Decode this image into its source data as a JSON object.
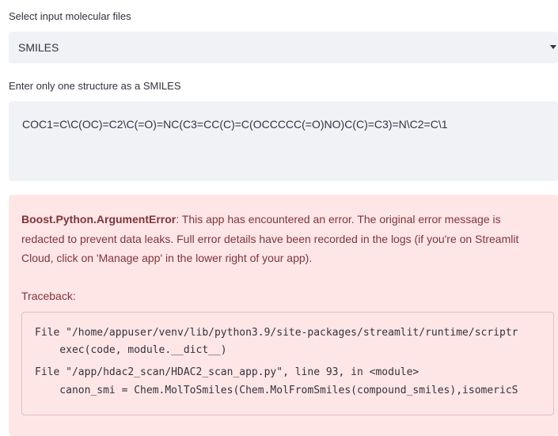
{
  "file_select": {
    "label": "Select input molecular files",
    "value": "SMILES",
    "icon": "chevron-down-icon"
  },
  "smiles_input": {
    "label": "Enter only one structure as a SMILES",
    "value": "COC1=C\\C(OC)=C2\\C(=O)=NC(C3=CC(C)=C(OCCCCC(=O)NO)C(C)=C3)=N\\C2=C\\1"
  },
  "error": {
    "name": "Boost.Python.ArgumentError",
    "message": ": This app has encountered an error. The original error message is redacted to prevent data leaks. Full error details have been recorded in the logs (if you're on Streamlit Cloud, click on 'Manage app' in the lower right of your app).",
    "traceback_label": "Traceback:",
    "traceback_lines": [
      "File \"/home/appuser/venv/lib/python3.9/site-packages/streamlit/runtime/scriptr",
      "    exec(code, module.__dict__)",
      "File \"/app/hdac2_scan/HDAC2_scan_app.py\", line 93, in <module>",
      "    canon_smi = Chem.MolToSmiles(Chem.MolFromSmiles(compound_smiles),isomericS"
    ]
  },
  "colors": {
    "input_background": "#f0f2f6",
    "error_background": "#ffe6e6",
    "error_text": "#7d353b",
    "body_text": "#31333f"
  }
}
